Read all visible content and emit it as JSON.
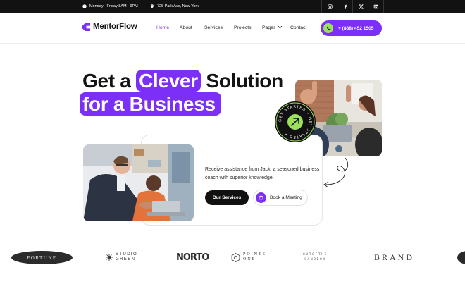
{
  "topbar": {
    "hours": "Monday - Friday 8AM - 9PM",
    "address": "725 Park Ave, New York",
    "socials": [
      "instagram-icon",
      "facebook-icon",
      "x-icon",
      "linkedin-icon"
    ]
  },
  "header": {
    "logo": "MentorFlow",
    "nav": [
      "Home",
      "About",
      "Services",
      "Projects",
      "Pages",
      "Contact"
    ],
    "active_nav": "Home",
    "phone": "+ (888) 452 1505"
  },
  "hero": {
    "line1_prefix": "Get a",
    "line1_highlight": "Clever",
    "line1_suffix": "Solution",
    "line2": "for a Business",
    "description": "Receive assistance from Jack, a seasoned business coach with superior knowledge.",
    "primary_button": "Our Services",
    "secondary_button": "Book a Meeting",
    "badge_text": "GET STARTED • GET STARTED • "
  },
  "brands": [
    "FORTUNE",
    "STUDIO",
    "GREEN",
    "NORTO",
    "POINTS",
    "ONE",
    "OUTOFTHE",
    "SANDBOX",
    "BRAND"
  ],
  "colors": {
    "accent": "#7b2ff7",
    "lime": "#9be15d",
    "dark": "#111111"
  }
}
